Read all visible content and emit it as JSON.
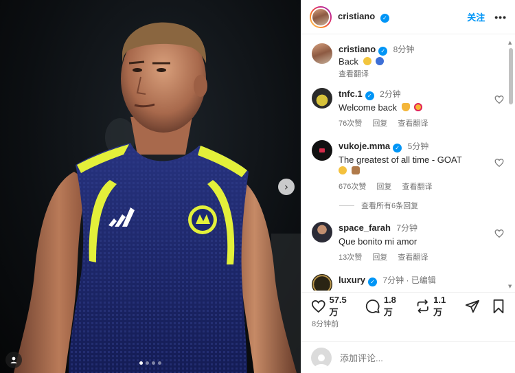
{
  "post": {
    "author": "cristiano",
    "follow_label": "关注",
    "more_label": "•••",
    "verified_mark": "✓"
  },
  "photo": {
    "next_label": "›",
    "slide_count": 4,
    "active_slide": 1
  },
  "caption": {
    "user": "cristiano",
    "time": "8分钟",
    "text": "Back",
    "translate_label": "查看翻译"
  },
  "comments": [
    {
      "user": "tnfc.1",
      "time": "2分钟",
      "text": "Welcome back",
      "likes": "76次赞",
      "reply_label": "回复",
      "translate_label": "查看翻译"
    },
    {
      "user": "vukoje.mma",
      "time": "5分钟",
      "text": "The greatest of all time - GOAT",
      "likes": "676次赞",
      "reply_label": "回复",
      "translate_label": "查看翻译"
    },
    {
      "user": "space_farah",
      "time": "7分钟",
      "text": "Que bonito mi amor",
      "likes": "13次赞",
      "reply_label": "回复",
      "translate_label": "查看翻译"
    },
    {
      "user": "luxury",
      "time": "7分钟 · 已编辑",
      "text": ""
    }
  ],
  "view_replies_label": "查看所有6条回复",
  "actions": {
    "likes": "57.5 万",
    "comments": "1.8 万",
    "reposts": "1.1 万"
  },
  "posted_ago": "8分钟前",
  "comment_placeholder": "添加评论...",
  "colors": {
    "accent": "#0095f6",
    "text": "#262626",
    "muted": "#737373",
    "jersey": "#1d2873",
    "jersey_trim": "#e3f03a"
  },
  "icons": [
    "chevron-right-icon",
    "user-tag-icon",
    "verified-icon",
    "more-icon",
    "heart-icon",
    "comment-icon",
    "repost-icon",
    "share-icon",
    "save-icon"
  ]
}
